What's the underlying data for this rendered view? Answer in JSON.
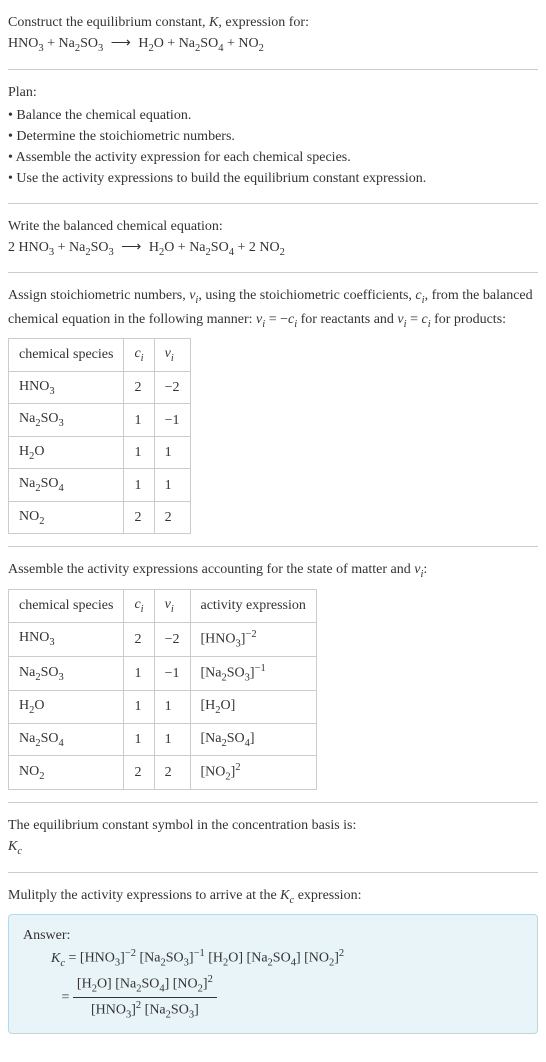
{
  "intro": {
    "line1": "Construct the equilibrium constant, K, expression for:",
    "equation": "HNO₃ + Na₂SO₃ ⟶ H₂O + Na₂SO₄ + NO₂"
  },
  "plan": {
    "heading": "Plan:",
    "items": [
      "Balance the chemical equation.",
      "Determine the stoichiometric numbers.",
      "Assemble the activity expression for each chemical species.",
      "Use the activity expressions to build the equilibrium constant expression."
    ]
  },
  "balanced": {
    "heading": "Write the balanced chemical equation:",
    "equation": "2 HNO₃ + Na₂SO₃ ⟶ H₂O + Na₂SO₄ + 2 NO₂"
  },
  "stoich": {
    "heading": "Assign stoichiometric numbers, νᵢ, using the stoichiometric coefficients, cᵢ, from the balanced chemical equation in the following manner: νᵢ = −cᵢ for reactants and νᵢ = cᵢ for products:",
    "headers": [
      "chemical species",
      "cᵢ",
      "νᵢ"
    ],
    "rows": [
      [
        "HNO₃",
        "2",
        "−2"
      ],
      [
        "Na₂SO₃",
        "1",
        "−1"
      ],
      [
        "H₂O",
        "1",
        "1"
      ],
      [
        "Na₂SO₄",
        "1",
        "1"
      ],
      [
        "NO₂",
        "2",
        "2"
      ]
    ]
  },
  "activity": {
    "heading": "Assemble the activity expressions accounting for the state of matter and νᵢ:",
    "headers": [
      "chemical species",
      "cᵢ",
      "νᵢ",
      "activity expression"
    ],
    "rows": [
      [
        "HNO₃",
        "2",
        "−2",
        "[HNO₃]⁻²"
      ],
      [
        "Na₂SO₃",
        "1",
        "−1",
        "[Na₂SO₃]⁻¹"
      ],
      [
        "H₂O",
        "1",
        "1",
        "[H₂O]"
      ],
      [
        "Na₂SO₄",
        "1",
        "1",
        "[Na₂SO₄]"
      ],
      [
        "NO₂",
        "2",
        "2",
        "[NO₂]²"
      ]
    ]
  },
  "symbol": {
    "line1": "The equilibrium constant symbol in the concentration basis is:",
    "line2": "K𝒸"
  },
  "multiply": {
    "heading": "Mulitply the activity expressions to arrive at the K𝒸 expression:"
  },
  "answer": {
    "label": "Answer:",
    "kc": "K𝒸 = ",
    "expr1": "[HNO₃]⁻² [Na₂SO₃]⁻¹ [H₂O] [Na₂SO₄] [NO₂]²",
    "eq": "= ",
    "num": "[H₂O] [Na₂SO₄] [NO₂]²",
    "den": "[HNO₃]² [Na₂SO₃]"
  }
}
